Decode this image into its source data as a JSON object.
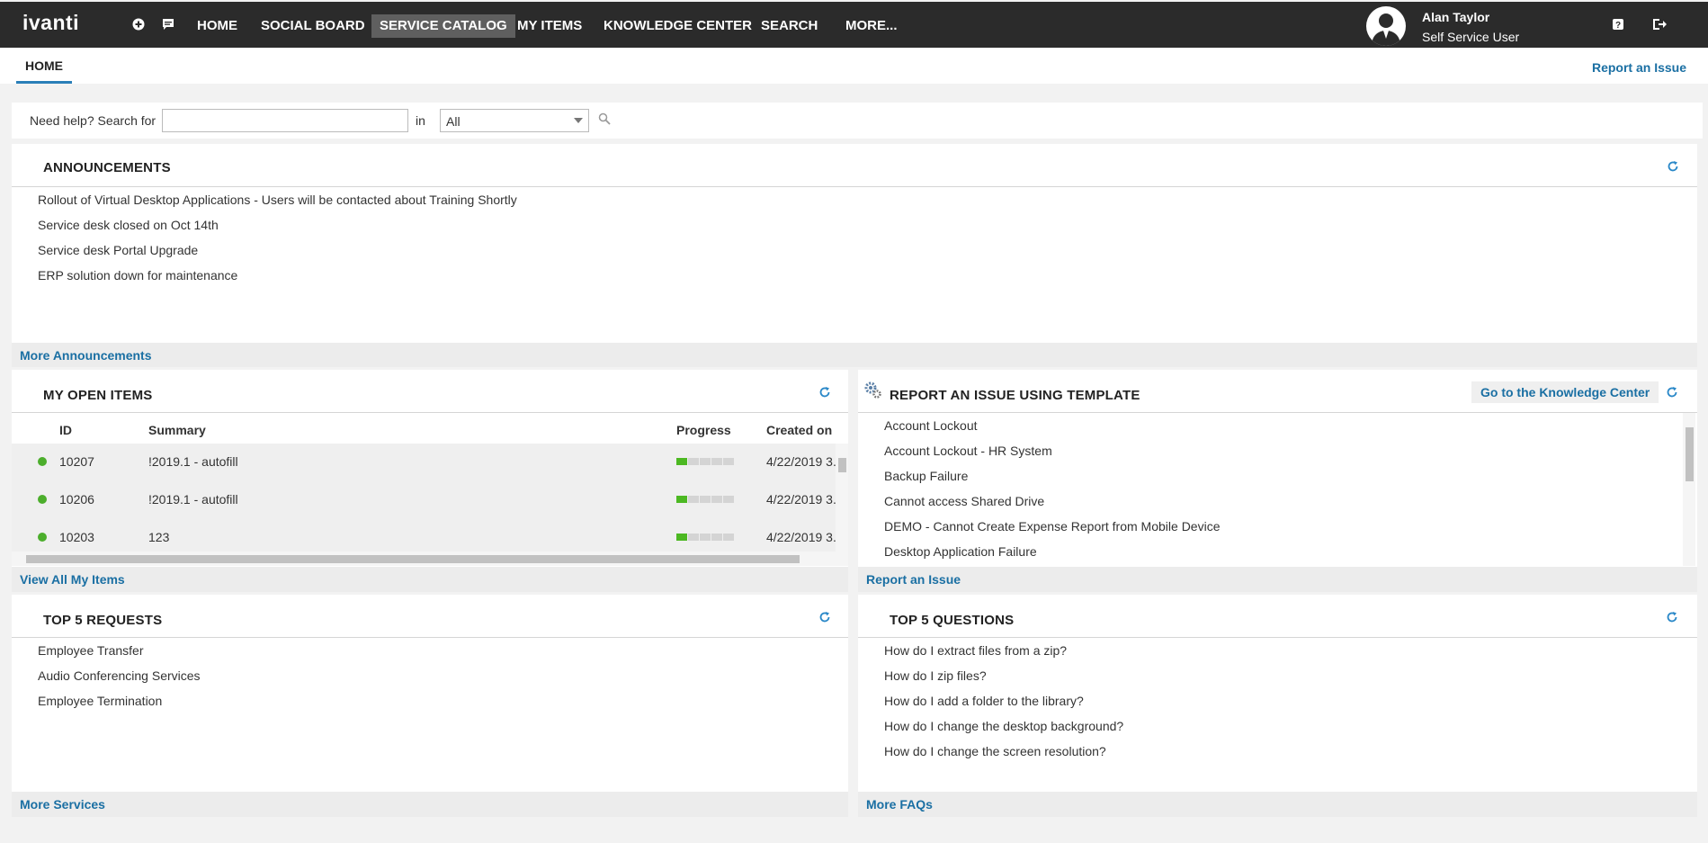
{
  "nav": {
    "logo": "ivanti",
    "items": [
      {
        "label": "HOME"
      },
      {
        "label": "SOCIAL BOARD"
      },
      {
        "label": "SERVICE CATALOG"
      },
      {
        "label": "MY ITEMS"
      },
      {
        "label": "KNOWLEDGE CENTER"
      },
      {
        "label": "SEARCH"
      },
      {
        "label": "MORE..."
      }
    ],
    "active_item": "SERVICE CATALOG",
    "user": {
      "name": "Alan Taylor",
      "role": "Self Service User"
    },
    "icons": [
      "add-icon",
      "chat-icon",
      "help-icon",
      "logout-icon"
    ]
  },
  "tabs": {
    "home": "HOME",
    "report_issue": "Report an Issue"
  },
  "search": {
    "label": "Need help? Search for",
    "value": "",
    "in_label": "in",
    "scope": "All"
  },
  "announcements": {
    "title": "ANNOUNCEMENTS",
    "items": [
      "Rollout of Virtual Desktop Applications - Users will be contacted about Training Shortly",
      "Service desk closed on Oct 14th",
      "Service desk Portal Upgrade",
      "ERP solution down for maintenance"
    ],
    "more": "More Announcements"
  },
  "open_items": {
    "title": "MY OPEN ITEMS",
    "columns": [
      "ID",
      "Summary",
      "Progress",
      "Created on"
    ],
    "rows": [
      {
        "id": "10207",
        "summary": "!2019.1 - autofill",
        "progress": 0.2,
        "created": "4/22/2019 3."
      },
      {
        "id": "10206",
        "summary": "!2019.1 - autofill",
        "progress": 0.2,
        "created": "4/22/2019 3."
      },
      {
        "id": "10203",
        "summary": "123",
        "progress": 0.2,
        "created": "4/22/2019 3."
      }
    ],
    "more": "View All My Items"
  },
  "templates": {
    "title": "REPORT AN ISSUE USING TEMPLATE",
    "kc_button": "Go to the Knowledge Center",
    "items": [
      "Account Lockout",
      "Account Lockout - HR System",
      "Backup Failure",
      "Cannot access Shared Drive",
      "DEMO - Cannot Create Expense Report from Mobile Device",
      "Desktop Application Failure"
    ],
    "more": "Report an Issue"
  },
  "top_requests": {
    "title": "TOP 5 REQUESTS",
    "items": [
      "Employee Transfer",
      "Audio Conferencing Services",
      "Employee Termination"
    ],
    "more": "More Services"
  },
  "top_questions": {
    "title": "TOP 5 QUESTIONS",
    "items": [
      "How do I extract files from a zip?",
      "How do I zip files?",
      "How do I add a folder to the library?",
      "How do I change the desktop background?",
      "How do I change the screen resolution?"
    ],
    "more": "More FAQs"
  },
  "colors": {
    "accent": "#1a6fa3",
    "nav_bg": "#2b2b2b",
    "status_ok": "#4cae2c"
  }
}
